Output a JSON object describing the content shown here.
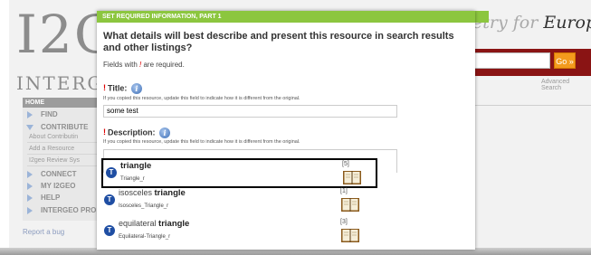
{
  "background": {
    "logo_text": "I2G",
    "logo_subtext": "INTERGE",
    "tagline_muted": "etry for ",
    "tagline_main": "Europe",
    "search_button": "Go »",
    "advanced_search": "Advanced Search",
    "sidebar": {
      "home": "HOME",
      "items": [
        {
          "label": "FIND"
        },
        {
          "label": "CONTRIBUTE"
        },
        {
          "label": "CONNECT"
        },
        {
          "label": "MY I2GEO"
        },
        {
          "label": "HELP"
        },
        {
          "label": "INTERGEO PRO"
        }
      ],
      "sub_items": [
        "About Contributin",
        "Add a Resource",
        "I2geo Review Sys"
      ]
    },
    "report_bug": "Report a bug"
  },
  "modal": {
    "header": "SET REQUIRED INFORMATION, PART 1",
    "question": "What details will best describe and present this resource in search results and other listings?",
    "fields_note_pre": "Fields with ",
    "fields_note_mark": "!",
    "fields_note_post": " are required.",
    "title_field": {
      "required_mark": "!",
      "label": "Title:",
      "help": "If you copied this resource, update this field to indicate how it is different from the original.",
      "value": "some test"
    },
    "description_field": {
      "required_mark": "!",
      "label": "Description:",
      "help": "If you copied this resource, update this field to indicate how it is different from the original."
    },
    "suggestions": [
      {
        "prefix": "",
        "term": "triangle",
        "file": "Triangle_r",
        "count": "[5]",
        "badge": "T"
      },
      {
        "prefix": "isosceles ",
        "term": "triangle",
        "file": "Isosceles_Triangle_r",
        "count": "[1]",
        "badge": "T"
      },
      {
        "prefix": "equilateral ",
        "term": "triangle",
        "file": "Equilateral-Triangle_r",
        "count": "[3]",
        "badge": "T"
      }
    ]
  },
  "colors": {
    "header_green": "#8cc63f",
    "badge_blue": "#1f4ea3",
    "go_orange": "#f39a1d",
    "search_bar_red": "#8a1414"
  }
}
